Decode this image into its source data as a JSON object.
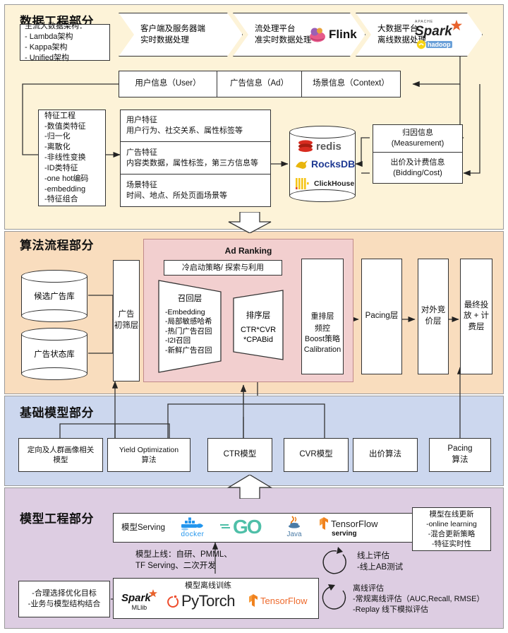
{
  "sections": {
    "data_engineering": {
      "title": "数据工程部分",
      "bg": "#fdf3d8"
    },
    "algorithm_flow": {
      "title": "算法流程部分",
      "bg": "#f9ddbe"
    },
    "base_model": {
      "title": "基础模型部分",
      "bg": "#ccd7ee"
    },
    "model_engineering": {
      "title": "模型工程部分",
      "bg": "#ddcde2"
    }
  },
  "data": {
    "architecture_box": "主流大数据架构：\n- Lambda架构\n- Kappa架构\n- Unified架构",
    "pipeline": [
      {
        "text": "客户端及服务器端\n实时数据处理",
        "logo": ""
      },
      {
        "text": "流处理平台\n准实时数据处理",
        "logo": "flink-logo"
      },
      {
        "text": "大数据平台\n离线数据处理",
        "logo": "spark-hadoop-logo"
      }
    ],
    "info_row": [
      "用户信息（User）",
      "广告信息（Ad）",
      "场景信息（Context）"
    ],
    "feature_engineering": "特征工程\n-数值类特征\n  -归一化\n  -离散化\n  -非线性变换\n-ID类特征\n  -one hot编码\n  -embedding\n-特征组合",
    "feature_types": [
      "用户特征\n用户行为、社交关系、属性标签等",
      "广告特征\n内容类数据，属性标签，第三方信息等",
      "场景特征\n时间、地点、所处页面场景等"
    ],
    "storage": {
      "items": [
        "redis",
        "RocksDB",
        "ClickHouse"
      ]
    },
    "measurement": "归因信息\n(Measurement)",
    "bidding_cost": "出价及计费信息\n(Bidding/Cost)"
  },
  "algorithm": {
    "ad_pool": "候选广告库",
    "ad_status": "广告状态库",
    "prefilter": "广告\n初筛层",
    "ad_ranking_label": "Ad Ranking",
    "coldstart": "冷启动策略/ 探索与利用",
    "recall": "召回层",
    "recall_items": "-Embedding\n-局部敏感哈希\n-热门广告召回\n-I2I召回\n-新鲜广告召回",
    "rank": "排序层",
    "rank_items": "CTR*CVR\n*CPABid",
    "rerank": "重排层",
    "rerank_items": "频控\nBoost策略\nCalibration",
    "pacing": "Pacing层",
    "auction": "对外竞\n价层",
    "delivery": "最终投\n放 + 计\n费层"
  },
  "base_models": [
    "定向及人群画像相关\n模型",
    "Yield Optimization\n算法",
    "CTR模型",
    "CVR模型",
    "出价算法",
    "Pacing\n算法"
  ],
  "model_engineering": {
    "serving_label": "模型Serving",
    "serving_logos": [
      "docker",
      "GO",
      "Java",
      "TensorFlow serving"
    ],
    "deploy_note": "模型上线：自研、PMML、\nTF Serving、二次开发",
    "training_label": "模型离线训练",
    "training_logos": [
      "Spark MLlib",
      "PyTorch",
      "TensorFlow"
    ],
    "objective_box": "-合理选择优化目标\n-业务与模型结构结合",
    "online_update": "模型在线更新\n-online learning\n-混合更新策略\n-特征实时性",
    "online_eval": "线上评估\n-线上AB测试",
    "offline_eval": "离线评估\n-常规离线评估（AUC,Recall, RMSE）\n-Replay 线下模拟评估"
  }
}
